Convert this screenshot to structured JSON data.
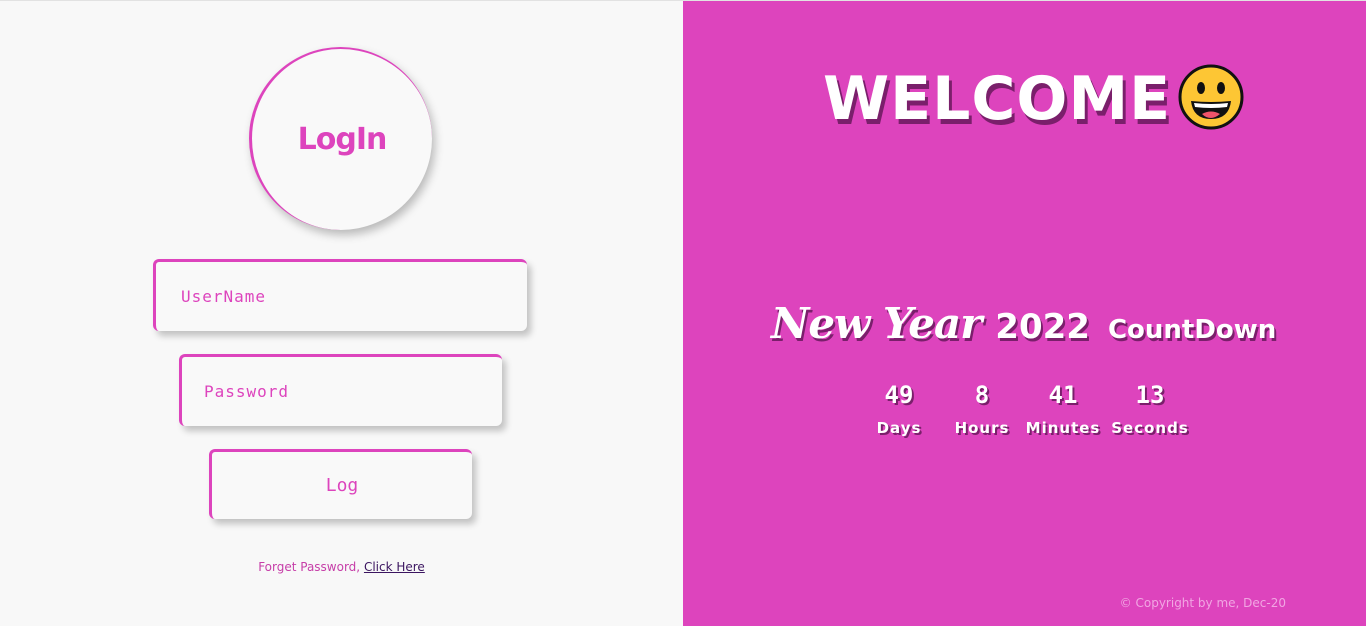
{
  "login": {
    "title": "LogIn",
    "username_placeholder": "UserName",
    "password_placeholder": "Password",
    "submit_label": "Log",
    "forget_text": "Forget Password, ",
    "forget_link": "Click Here"
  },
  "welcome": {
    "title": "WELCOME",
    "icon": "grinning-face-icon"
  },
  "countdown": {
    "title": "New Year",
    "year": "2022",
    "subtitle": "CountDown",
    "units": [
      {
        "value": "49",
        "label": "Days"
      },
      {
        "value": "8",
        "label": "Hours"
      },
      {
        "value": "41",
        "label": "Minutes"
      },
      {
        "value": "13",
        "label": "Seconds"
      }
    ]
  },
  "footer": {
    "copyright": "© Copyright by me, Dec-20"
  },
  "colors": {
    "accent": "#dd44bd",
    "panel_bg": "#f8f8f8",
    "link": "#3b1560"
  }
}
